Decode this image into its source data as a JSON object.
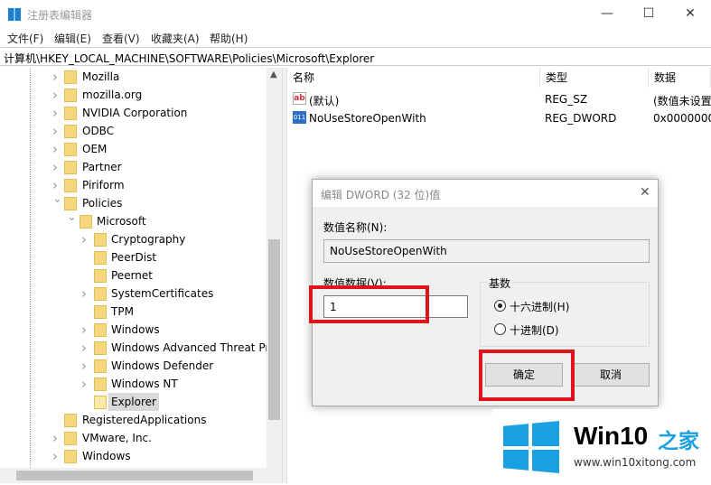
{
  "window": {
    "title": "注册表编辑器",
    "minimize": "—",
    "maximize": "☐",
    "close": "✕"
  },
  "menu": [
    "文件(F)",
    "编辑(E)",
    "查看(V)",
    "收藏夹(A)",
    "帮助(H)"
  ],
  "address": "计算机\\HKEY_LOCAL_MACHINE\\SOFTWARE\\Policies\\Microsoft\\Explorer",
  "tree": [
    {
      "label": "Mozilla",
      "level": 1,
      "expand": ">"
    },
    {
      "label": "mozilla.org",
      "level": 1,
      "expand": ">"
    },
    {
      "label": "NVIDIA Corporation",
      "level": 1,
      "expand": ">"
    },
    {
      "label": "ODBC",
      "level": 1,
      "expand": ">"
    },
    {
      "label": "OEM",
      "level": 1,
      "expand": ">"
    },
    {
      "label": "Partner",
      "level": 1,
      "expand": ">"
    },
    {
      "label": "Piriform",
      "level": 1,
      "expand": ">"
    },
    {
      "label": "Policies",
      "level": 1,
      "expand": "v"
    },
    {
      "label": "Microsoft",
      "level": 2,
      "expand": "v"
    },
    {
      "label": "Cryptography",
      "level": 3,
      "expand": ">"
    },
    {
      "label": "PeerDist",
      "level": 3,
      "expand": ""
    },
    {
      "label": "Peernet",
      "level": 3,
      "expand": ""
    },
    {
      "label": "SystemCertificates",
      "level": 3,
      "expand": ">"
    },
    {
      "label": "TPM",
      "level": 3,
      "expand": ""
    },
    {
      "label": "Windows",
      "level": 3,
      "expand": ">"
    },
    {
      "label": "Windows Advanced Threat Pr",
      "level": 3,
      "expand": ">"
    },
    {
      "label": "Windows Defender",
      "level": 3,
      "expand": ">"
    },
    {
      "label": "Windows NT",
      "level": 3,
      "expand": ">"
    },
    {
      "label": "Explorer",
      "level": 3,
      "expand": "",
      "selected": true
    },
    {
      "label": "RegisteredApplications",
      "level": 1,
      "expand": ""
    },
    {
      "label": "VMware, Inc.",
      "level": 1,
      "expand": ">"
    },
    {
      "label": "Windows",
      "level": 1,
      "expand": ">"
    }
  ],
  "list": {
    "headers": [
      "名称",
      "类型",
      "数据"
    ],
    "rows": [
      {
        "icon": "string-value-icon",
        "name": "(默认)",
        "type": "REG_SZ",
        "data": "(数值未设置"
      },
      {
        "icon": "binary-value-icon",
        "name": "NoUseStoreOpenWith",
        "type": "REG_DWORD",
        "data": "0x0000000"
      }
    ]
  },
  "dialog": {
    "title": "编辑 DWORD (32 位)值",
    "close": "✕",
    "name_label": "数值名称(N):",
    "name_value": "NoUseStoreOpenWith",
    "data_label": "数值数据(V):",
    "data_value": "1",
    "base_label": "基数",
    "hex": "十六进制(H)",
    "dec": "十进制(D)",
    "selected_base": "hex",
    "ok": "确定",
    "cancel": "取消"
  },
  "watermark": {
    "brand": "Win10",
    "brand_cn": "之家",
    "url": "www.win10xitong.com"
  },
  "colors": {
    "highlight": "#e0131b",
    "logo": "#1ba1e2"
  }
}
